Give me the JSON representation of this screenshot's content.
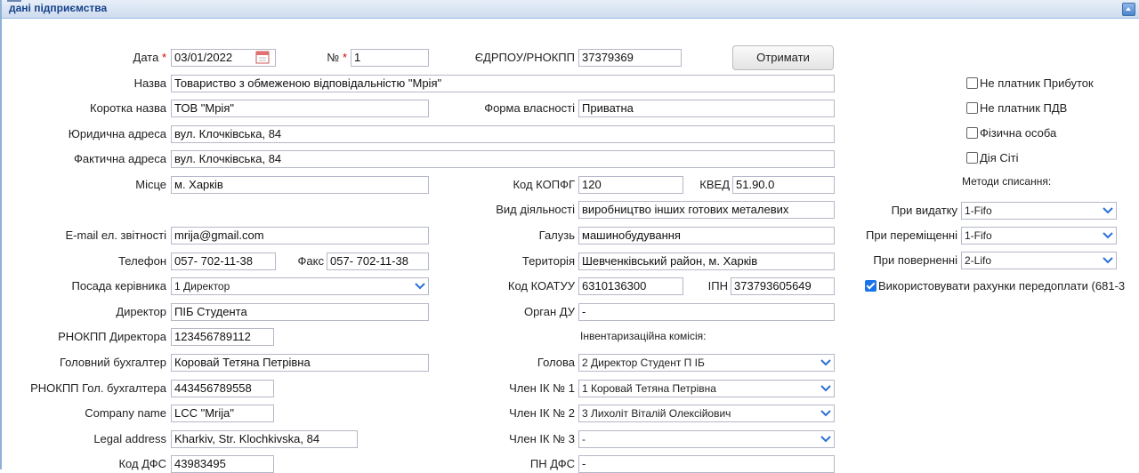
{
  "panel": {
    "title": "дані підприємства"
  },
  "form": {
    "date": {
      "label": "Дата",
      "value": "03/01/2022"
    },
    "number": {
      "label": "№",
      "value": "1"
    },
    "edrpou": {
      "label": "ЄДРПОУ/РНОКПП",
      "value": "37379369"
    },
    "get_button": "Отримати",
    "name": {
      "label": "Назва",
      "value": "Товариство з обмеженою відповідальністю \"Мрія\""
    },
    "short_name": {
      "label": "Коротка назва",
      "value": "ТОВ \"Мрія\""
    },
    "ownership": {
      "label": "Форма власності",
      "value": "Приватна"
    },
    "legal_addr": {
      "label": "Юридична адреса",
      "value": "вул. Клочківська, 84"
    },
    "actual_addr": {
      "label": "Фактична адреса",
      "value": "вул. Клочківська, 84"
    },
    "place": {
      "label": "Місце",
      "value": "м. Харків"
    },
    "kopfg": {
      "label": "Код КОПФГ",
      "value": "120"
    },
    "kved": {
      "label": "КВЕД",
      "value": "51.90.0"
    },
    "activity": {
      "label": "Вид діяльності",
      "value": "виробництво  інших готових металевих"
    },
    "email": {
      "label": "E-mail ел. звітності",
      "value": "mrija@gmail.com"
    },
    "industry": {
      "label": "Галузь",
      "value": "машинобудування"
    },
    "phone": {
      "label": "Телефон",
      "value": "057- 702-11-38"
    },
    "fax": {
      "label": "Факс",
      "value": "057- 702-11-38"
    },
    "territory": {
      "label": "Територія",
      "value": "Шевченківський район, м. Харків"
    },
    "head_position": {
      "label": "Посада керівника",
      "value": "1 Директор"
    },
    "koatuu": {
      "label": "Код КОАТУУ",
      "value": "6310136300"
    },
    "ipn": {
      "label": "ІПН",
      "value": "373793605649"
    },
    "director": {
      "label": "Директор",
      "value": "ПІБ Студента"
    },
    "organ_du": {
      "label": "Орган ДУ",
      "value": "-"
    },
    "director_rnokpp": {
      "label": "РНОКПП Директора",
      "value": "123456789112"
    },
    "inventory_title": "Інвентаризаційна комісія:",
    "chief_accountant": {
      "label": "Головний бухгалтер",
      "value": "Коровай Тетяна Петрівна"
    },
    "chairman": {
      "label": "Голова",
      "value": "2 Директор Студент П ІБ"
    },
    "accountant_rnokpp": {
      "label": "РНОКПП Гол. бухгалтера",
      "value": "443456789558"
    },
    "member1": {
      "label": "Член ІК № 1",
      "value": "1 Коровай Тетяна Петрівна"
    },
    "company_name": {
      "label": "Company name",
      "value": "LCC \"Mrija\""
    },
    "member2": {
      "label": "Член ІК № 2",
      "value": "3 Лихоліт Віталій Олексійович"
    },
    "legal_address_en": {
      "label": "Legal address",
      "value": "Kharkiv, Str. Klochkivska, 84"
    },
    "member3": {
      "label": "Член ІК № 3",
      "value": "-"
    },
    "dfs_code": {
      "label": "Код ДФС",
      "value": "43983495"
    },
    "pn_dfs": {
      "label": "ПН ДФС",
      "value": "-"
    }
  },
  "options": {
    "not_profit_payer": {
      "label": "Не платник Прибуток",
      "checked": false
    },
    "not_vat_payer": {
      "label": "Не платник ПДВ",
      "checked": false
    },
    "individual": {
      "label": "Фізична особа",
      "checked": false
    },
    "dia_city": {
      "label": "Дія Сіті",
      "checked": false
    },
    "writeoff_title": "Методи списання:",
    "on_issue": {
      "label": "При видатку",
      "value": "1-Fifo"
    },
    "on_move": {
      "label": "При переміщенні",
      "value": "1-Fifo"
    },
    "on_return": {
      "label": "При поверненні",
      "value": "2-Lifo"
    },
    "prepay_accounts": {
      "label": "Використовувати рахунки передоплати (681-3",
      "checked": true
    }
  },
  "colors": {
    "accent": "#1a73e8",
    "header": "#15428b",
    "combo_arrow": "#2b6fd6",
    "required": "#dd0000"
  }
}
